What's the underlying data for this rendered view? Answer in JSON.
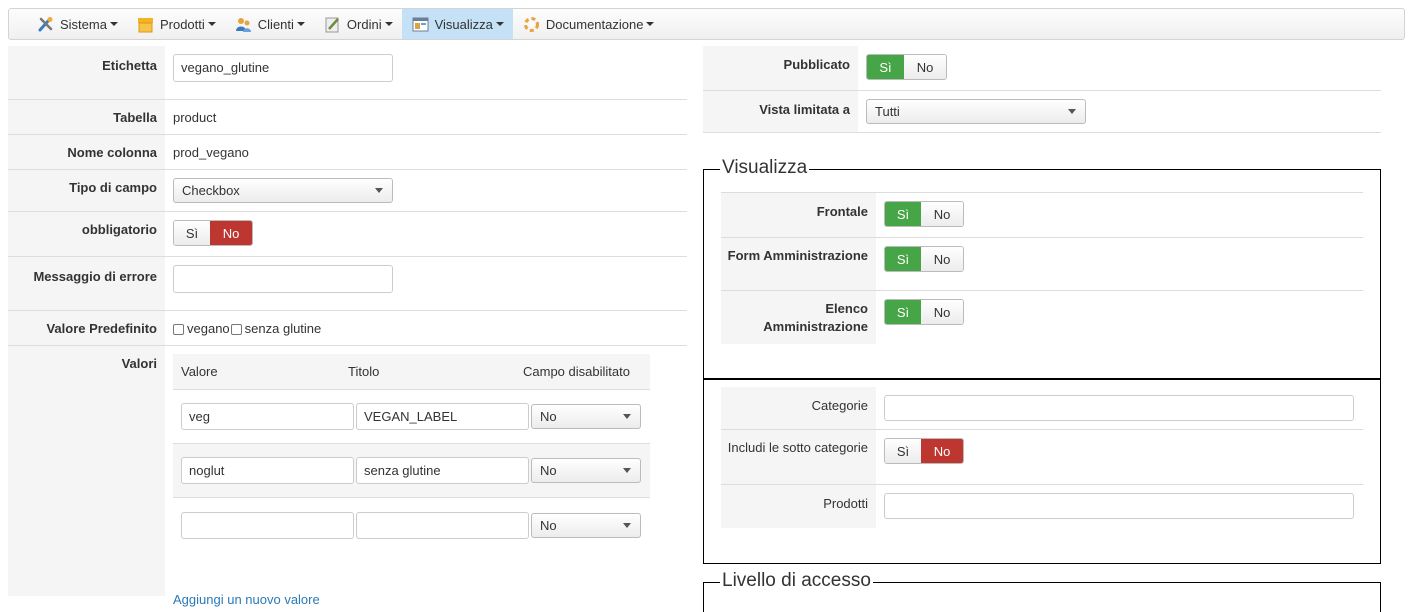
{
  "menu": {
    "items": [
      {
        "label": "Sistema",
        "icon": "tools-icon"
      },
      {
        "label": "Prodotti",
        "icon": "box-icon"
      },
      {
        "label": "Clienti",
        "icon": "users-icon"
      },
      {
        "label": "Ordini",
        "icon": "pencil-icon"
      },
      {
        "label": "Visualizza",
        "icon": "window-icon",
        "active": true
      },
      {
        "label": "Documentazione",
        "icon": "lifebuoy-icon"
      }
    ]
  },
  "form": {
    "etichetta": {
      "label": "Etichetta",
      "value": "vegano_glutine"
    },
    "tabella": {
      "label": "Tabella",
      "value": "product"
    },
    "nome_colonna": {
      "label": "Nome colonna",
      "value": "prod_vegano"
    },
    "tipo_campo": {
      "label": "Tipo di campo",
      "value": "Checkbox"
    },
    "obbligatorio": {
      "label": "obbligatorio",
      "yes": "Sì",
      "no": "No",
      "selected": "No"
    },
    "messaggio_errore": {
      "label": "Messaggio di errore",
      "value": ""
    },
    "valore_predefinito": {
      "label": "Valore Predefinito",
      "options": [
        "vegano",
        "senza glutine"
      ]
    },
    "valori": {
      "label": "Valori",
      "headers": [
        "Valore",
        "Titolo",
        "Campo disabilitato"
      ],
      "rows": [
        {
          "valore": "veg",
          "titolo": "VEGAN_LABEL",
          "disabilitato": "No"
        },
        {
          "valore": "noglut",
          "titolo": "senza glutine",
          "disabilitato": "No"
        },
        {
          "valore": "",
          "titolo": "",
          "disabilitato": "No"
        }
      ],
      "add_link": "Aggiungi un nuovo valore"
    }
  },
  "right": {
    "pubblicato": {
      "label": "Pubblicato",
      "yes": "Sì",
      "no": "No",
      "selected": "Sì"
    },
    "vista_limitata": {
      "label": "Vista limitata a",
      "value": "Tutti"
    },
    "visualizza": {
      "legend": "Visualizza",
      "frontale": {
        "label": "Frontale",
        "yes": "Sì",
        "no": "No",
        "selected": "Sì"
      },
      "form_amm": {
        "label": "Form Amministrazione",
        "yes": "Sì",
        "no": "No",
        "selected": "Sì"
      },
      "elenco_amm": {
        "label": "Elenco Amministrazione",
        "yes": "Sì",
        "no": "No",
        "selected": "Sì"
      }
    },
    "categorie": {
      "categorie_label": "Categorie",
      "categorie_value": "",
      "includi_label": "Includi le sotto categorie",
      "includi_yes": "Sì",
      "includi_no": "No",
      "includi_selected": "No",
      "prodotti_label": "Prodotti",
      "prodotti_value": ""
    },
    "livello": {
      "legend": "Livello di accesso"
    }
  },
  "colors": {
    "green": "#46a546",
    "red": "#bd362f",
    "active_menu": "#c5e1f5",
    "link": "#2a7ab8"
  }
}
